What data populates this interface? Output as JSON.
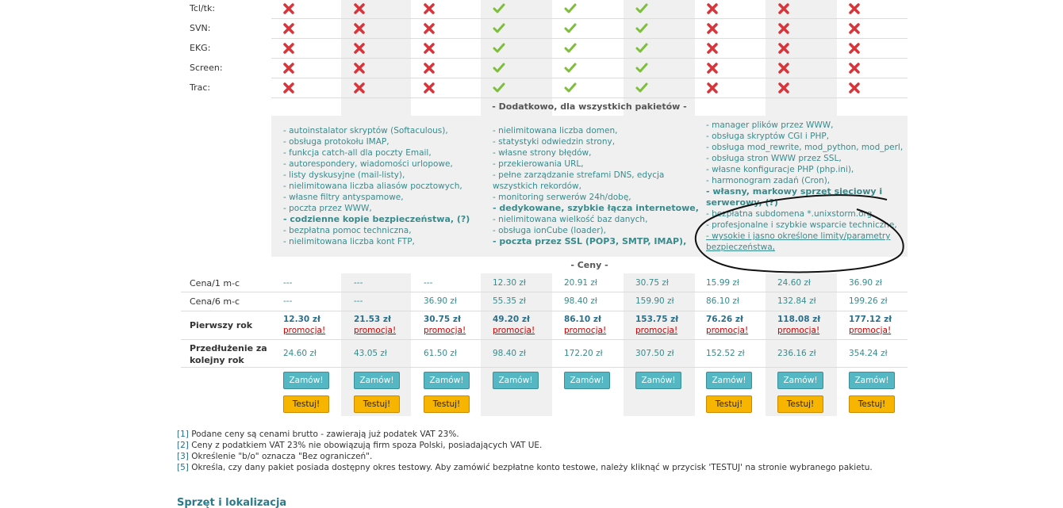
{
  "features": {
    "rows": [
      {
        "label": "Tcl/tk:",
        "values": [
          false,
          false,
          false,
          true,
          true,
          true,
          false,
          false,
          false
        ]
      },
      {
        "label": "SVN:",
        "values": [
          false,
          false,
          false,
          true,
          true,
          true,
          false,
          false,
          false
        ]
      },
      {
        "label": "EKG:",
        "values": [
          false,
          false,
          false,
          true,
          true,
          true,
          false,
          false,
          false
        ]
      },
      {
        "label": "Screen:",
        "values": [
          false,
          false,
          false,
          true,
          true,
          true,
          false,
          false,
          false
        ]
      },
      {
        "label": "Trac:",
        "values": [
          false,
          false,
          false,
          true,
          true,
          true,
          false,
          false,
          false
        ]
      }
    ]
  },
  "extras": {
    "heading": "- Dodatkowo, dla wszystkich pakietów -",
    "col1": [
      "- autoinstalator skryptów (Softaculous),",
      "- obsługa protokołu IMAP,",
      "- funkcja catch-all dla poczty Email,",
      "- autorespondery, wiadomości urlopowe,",
      "- listy dyskusyjne (mail-listy),",
      "- nielimitowana liczba aliasów pocztowych,",
      "- własne filtry antyspamowe,",
      "- poczta przez WWW,",
      "- codzienne kopie bezpieczeństwa, (?)",
      "- bezpłatna pomoc techniczna,",
      "- nielimitowana liczba kont FTP,"
    ],
    "col2": [
      "- nielimitowana liczba domen,",
      "- statystyki odwiedzin strony,",
      "- własne strony błędów,",
      "- przekierowania URL,",
      "- pełne zarządzanie strefami DNS, edycja",
      "wszystkich rekordów,",
      "- monitoring serwerów 24h/dobę,",
      "- dedykowane, szybkie łącza internetowe,",
      "- nielimitowana wielkość baz danych,",
      "- obsługa ionCube (loader),",
      "- poczta przez SSL (POP3, SMTP, IMAP),"
    ],
    "col3": [
      "- manager plików przez WWW,",
      "- obsługa skryptów CGI i PHP,",
      "- obsługa mod_rewrite, mod_python, mod_perl,",
      "- obsługa stron WWW przez SSL,",
      "- własne konfiguracje PHP (php.ini),",
      "- harmonogram zadań (Cron),",
      "- własny, markowy sprzęt sieciowy i",
      "serwerowy, (?)",
      "- bezpłatna subdomena *.unixstorm.org,",
      "- profesjonalne i szybkie wsparcie techniczne,",
      "- wysokie i jasno określone limity/parametry",
      "bezpieczeństwa,"
    ]
  },
  "prices": {
    "heading": "- Ceny -",
    "month1": {
      "label": "Cena/1 m-c",
      "values": [
        "---",
        "---",
        "---",
        "12.30 zł",
        "20.91 zł",
        "30.75 zł",
        "15.99 zł",
        "24.60 zł",
        "36.90 zł"
      ]
    },
    "month6": {
      "label": "Cena/6 m-c",
      "values": [
        "---",
        "---",
        "36.90 zł",
        "55.35 zł",
        "98.40 zł",
        "159.90 zł",
        "86.10 zł",
        "132.84 zł",
        "199.26 zł"
      ]
    },
    "first_year": {
      "label": "Pierwszy rok",
      "values": [
        "12.30 zł",
        "21.53 zł",
        "30.75 zł",
        "49.20 zł",
        "86.10 zł",
        "153.75 zł",
        "76.26 zł",
        "118.08 zł",
        "177.12 zł"
      ],
      "promo": "promocja!"
    },
    "renewal": {
      "label_line1": "Przedłużenie za",
      "label_line2": "kolejny rok",
      "values": [
        "24.60 zł",
        "43.05 zł",
        "61.50 zł",
        "98.40 zł",
        "172.20 zł",
        "307.50 zł",
        "152.52 zł",
        "236.16 zł",
        "354.24 zł"
      ]
    }
  },
  "buttons": {
    "order": "Zamów!",
    "test": "Testuj!",
    "test_available": [
      true,
      true,
      true,
      false,
      false,
      false,
      true,
      true,
      true
    ]
  },
  "footnotes": [
    {
      "num": "[1]",
      "text": " Podane ceny są cenami brutto - zawierają już podatek VAT 23%."
    },
    {
      "num": "[2]",
      "text": " Ceny z podatkiem VAT 23% nie obowiązują firm spoza Polski, posiadających VAT UE."
    },
    {
      "num": "[3]",
      "text": " Określenie \"b/o\" oznacza \"Bez ograniczeń\"."
    },
    {
      "num": "[5]",
      "text": " Określa, czy dany pakiet posiada dostępny okres testowy. Aby zamówić bezpłatne konto testowe, należy kliknąć w przycisk 'TESTUJ' na stronie wybranego pakietu."
    }
  ],
  "footer_title": "Sprzęt i lokalizacja",
  "colors": {
    "check": "#7dbf3a",
    "cross": "#d9343a",
    "accent": "#3a8a8c",
    "promo": "#cc0000",
    "order_btn": "#56b7c4",
    "test_btn": "#f7b500"
  }
}
